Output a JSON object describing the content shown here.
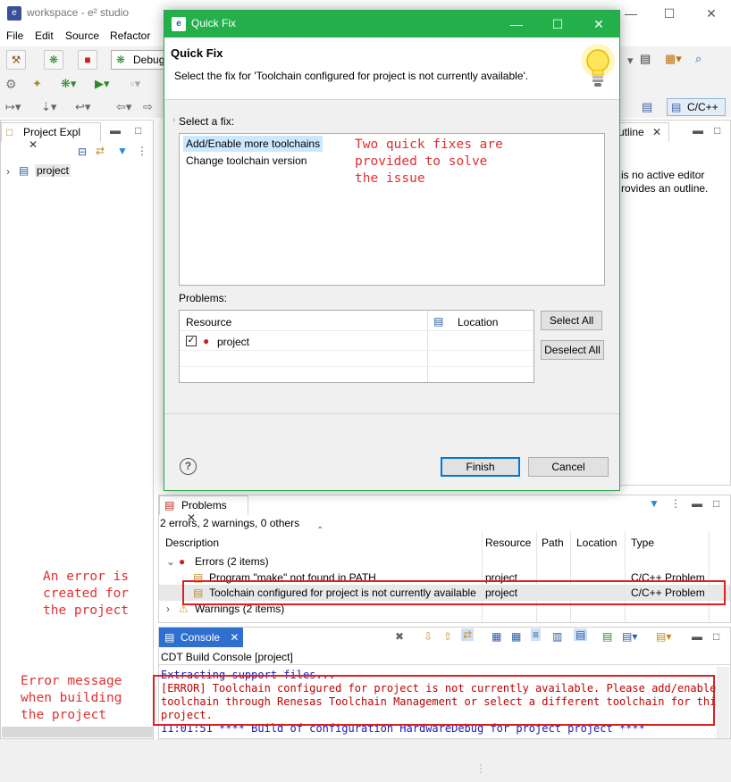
{
  "window": {
    "title": "workspace - e² studio",
    "minimize": "—",
    "maximize": "☐",
    "close": "✕"
  },
  "menu": [
    "File",
    "Edit",
    "Source",
    "Refactor"
  ],
  "toolbar": {
    "launch_config": "Debug"
  },
  "perspective": {
    "label": "C/C++"
  },
  "project_explorer": {
    "tab": "Project Expl",
    "project": "project"
  },
  "outline": {
    "tab": "utline",
    "message_line1": "is no active editor",
    "message_line2": "rovides an outline."
  },
  "dialog": {
    "title": "Quick Fix",
    "heading": "Quick Fix",
    "description": "Select the fix for 'Toolchain configured for project is not currently available'.",
    "select_label": "Select a fix:",
    "fixes": [
      "Add/Enable more toolchains",
      "Change toolchain version"
    ],
    "problems_label": "Problems:",
    "problems_columns": [
      "Resource",
      "Location"
    ],
    "problems_rows": [
      {
        "resource": "project",
        "checked": true
      }
    ],
    "select_all": "Select All",
    "deselect_all": "Deselect All",
    "finish": "Finish",
    "cancel": "Cancel",
    "help": "?"
  },
  "annotations": {
    "quick_fixes": "Two quick fixes are\nprovided to solve\nthe issue",
    "error_created": "An error is\ncreated for\nthe project",
    "error_message": "Error message\nwhen building\nthe project"
  },
  "problems_view": {
    "tab": "Problems",
    "summary": "2 errors, 2 warnings, 0 others",
    "columns": [
      "Description",
      "Resource",
      "Path",
      "Location",
      "Type"
    ],
    "errors_group": "Errors (2 items)",
    "warnings_group": "Warnings (2 items)",
    "rows": [
      {
        "description": "Program \"make\" not found in PATH",
        "resource": "project",
        "type": "C/C++ Problem"
      },
      {
        "description": "Toolchain configured for project is not currently available",
        "resource": "project",
        "type": "C/C++ Problem"
      }
    ]
  },
  "console": {
    "tab": "Console",
    "header": "CDT Build Console [project]",
    "lines": [
      "Extracting support files...",
      "[ERROR] Toolchain configured for project is not currently available. Please add/enable",
      "toolchain through Renesas Toolchain Management or select a different toolchain for this",
      "project.",
      "11:01:51 **** Build of configuration HardwareDebug for project project ****"
    ]
  },
  "colors": {
    "dialog_title": "#23b04b",
    "annotation": "#e03030",
    "console_tab": "#2e6fd0",
    "error_text": "#c00000",
    "console_text": "#1a1ab0"
  }
}
